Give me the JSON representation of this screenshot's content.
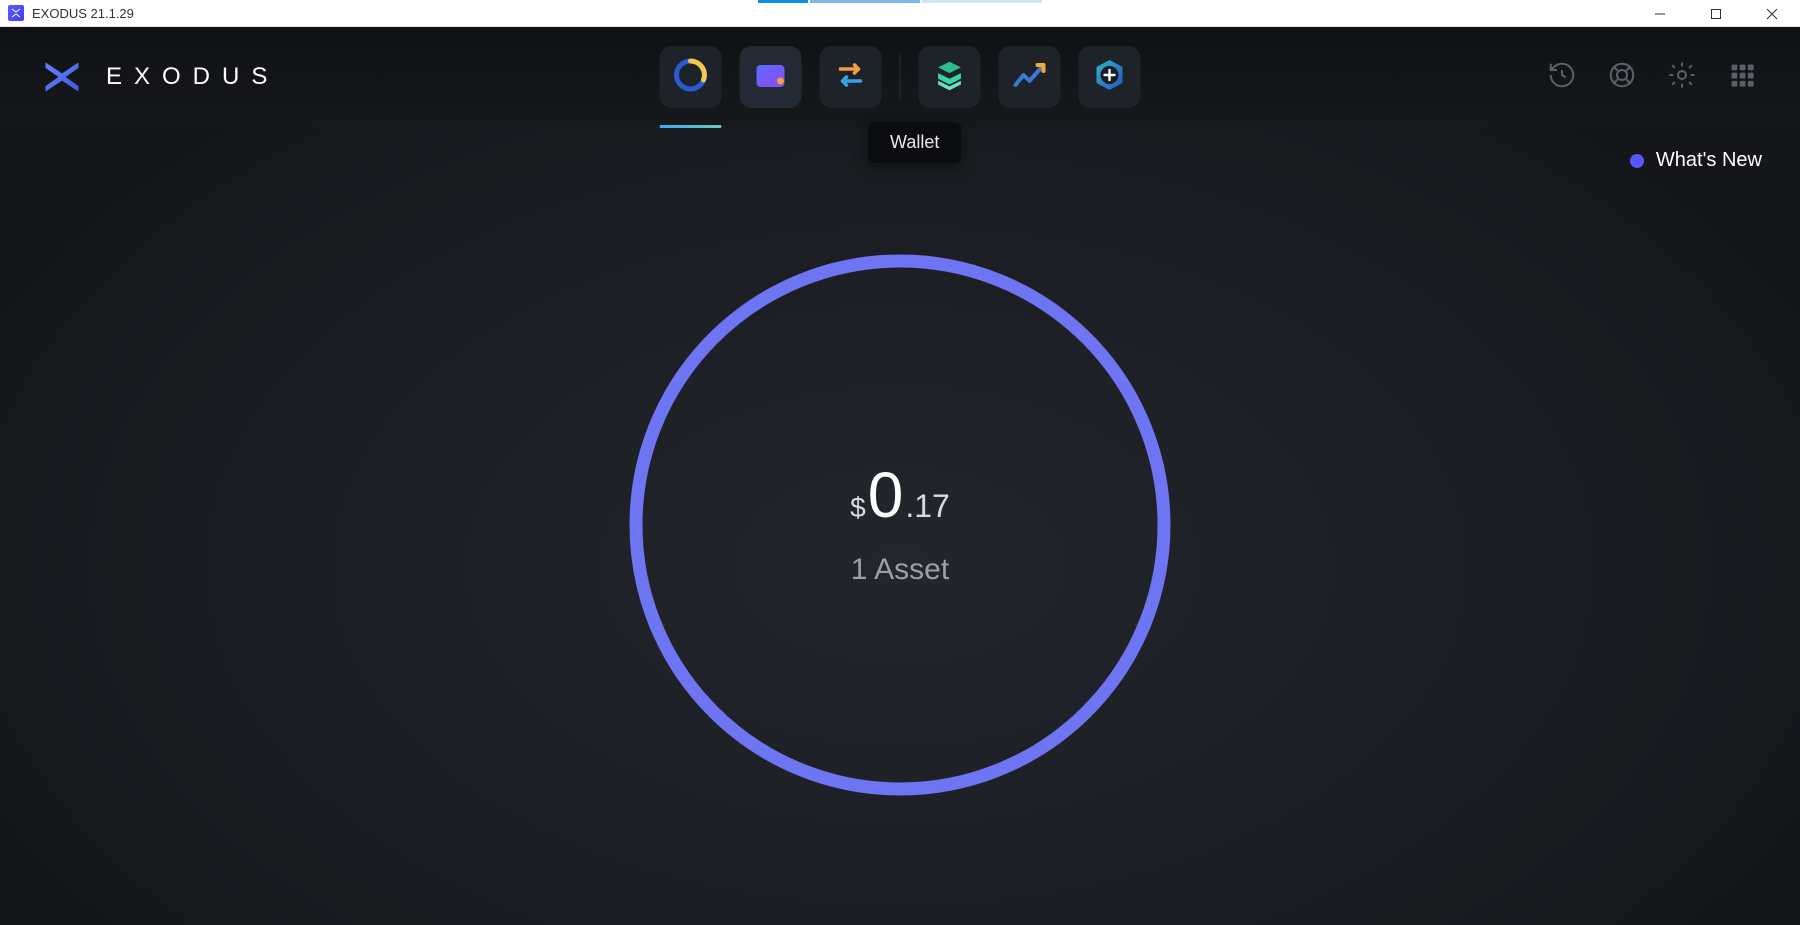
{
  "window": {
    "title": "EXODUS 21.1.29"
  },
  "brand": {
    "name": "EXODUS"
  },
  "nav": {
    "tooltip": "Wallet",
    "items": [
      {
        "name": "portfolio",
        "icon": "donut-icon",
        "active": true
      },
      {
        "name": "wallet",
        "icon": "wallet-icon",
        "active": false,
        "hover": true
      },
      {
        "name": "exchange",
        "icon": "exchange-icon",
        "active": false
      },
      {
        "name": "rewards",
        "icon": "stack-icon",
        "active": false
      },
      {
        "name": "market",
        "icon": "trend-icon",
        "active": false
      },
      {
        "name": "apps",
        "icon": "apps-plus-icon",
        "active": false
      }
    ]
  },
  "headerRight": {
    "history": "history-icon",
    "support": "lifebuoy-icon",
    "settings": "gear-icon",
    "grid": "grid-icon"
  },
  "whatsNew": {
    "label": "What's New"
  },
  "portfolio": {
    "currencySymbol": "$",
    "balanceInteger": "0",
    "balanceDecimal": ".17",
    "assetLine": "1 Asset"
  },
  "colors": {
    "ring": "#6e74f2",
    "accentDot": "#5557ff"
  }
}
